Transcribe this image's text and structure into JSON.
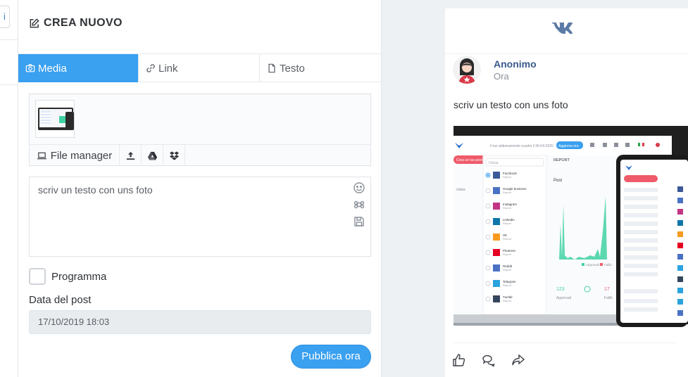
{
  "sidebar": {
    "tab_glyph": "i"
  },
  "editor": {
    "title": "CREA NUOVO",
    "tabs": [
      {
        "label": "Media",
        "icon": "camera-icon",
        "active": true
      },
      {
        "label": "Link",
        "icon": "link-icon",
        "active": false
      },
      {
        "label": "Testo",
        "icon": "file-icon",
        "active": false
      }
    ],
    "media": {
      "file_manager_label": "File manager",
      "tools": [
        "upload-icon",
        "google-drive-icon",
        "dropbox-icon"
      ]
    },
    "text_value": "scriv un testo con uns foto",
    "text_tools": [
      "emoji-icon",
      "command-icon",
      "save-icon"
    ],
    "schedule_label": "Programma",
    "schedule_checked": false,
    "date_label": "Data del post",
    "date_value": "17/10/2019 18:03",
    "publish_label": "Pubblica ora"
  },
  "preview": {
    "network": "VK",
    "author": "Anonimo",
    "time": "Ora",
    "text": "scriv un testo con uns foto",
    "image": {
      "search_placeholder": "Cerca",
      "report_label": "REPORT",
      "post_label": "Post",
      "upgrade_button": "Aggiorna ora",
      "network_list": [
        {
          "name": "Facebook",
          "sub": "Report"
        },
        {
          "name": "Google business",
          "sub": "Report"
        },
        {
          "name": "Instagram",
          "sub": "Report"
        },
        {
          "name": "Linkedin",
          "sub": "Report"
        },
        {
          "name": "Ok",
          "sub": "Report"
        },
        {
          "name": "Pinterest",
          "sub": "Report"
        },
        {
          "name": "Reddit",
          "sub": "Report"
        },
        {
          "name": "Telegram",
          "sub": "Report"
        },
        {
          "name": "Tumblr",
          "sub": "Report"
        }
      ],
      "stats": [
        {
          "value": "123",
          "label": "Approvati"
        },
        {
          "value": "17",
          "label": "Falliti"
        }
      ],
      "legend": [
        "Approvati",
        "Falliti"
      ]
    },
    "actions": [
      "like-icon",
      "comment-icon",
      "share-icon"
    ]
  },
  "colors": {
    "accent": "#3aa0f0",
    "vk_blue": "#5b7ba6",
    "author": "#3a5a8c"
  }
}
